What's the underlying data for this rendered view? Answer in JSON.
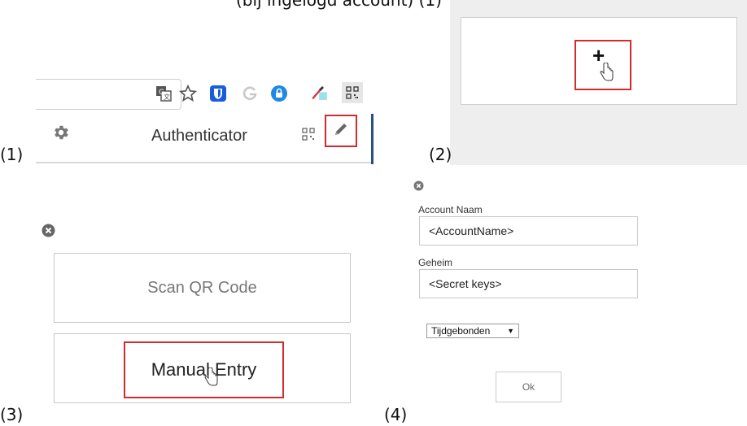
{
  "captions": {
    "top_partial": "(bij ingelogd account)             (1)",
    "step1": "(1)",
    "step2": "(2)",
    "step3": "(3)",
    "step4": "(4)"
  },
  "panel1": {
    "title": "Authenticator",
    "icons": [
      "translate-icon",
      "star-icon",
      "bitwarden-icon",
      "g-icon",
      "lock-icon",
      "eyedropper-icon",
      "qr-extension-icon",
      "gear-icon",
      "qr-scan-icon",
      "pencil-icon"
    ]
  },
  "panel2": {
    "add_label": "+"
  },
  "panel3": {
    "scan_label": "Scan QR Code",
    "manual_label": "Manual Entry"
  },
  "panel4": {
    "account_label": "Account Naam",
    "account_value": "<AccountName>",
    "secret_label": "Geheim",
    "secret_value": "<Secret keys>",
    "type_select": "Tijdgebonden",
    "ok_label": "Ok"
  },
  "colors": {
    "highlight": "#d12c2c",
    "panel_bg": "#eeeeee",
    "divider_blue": "#2a4f85"
  }
}
